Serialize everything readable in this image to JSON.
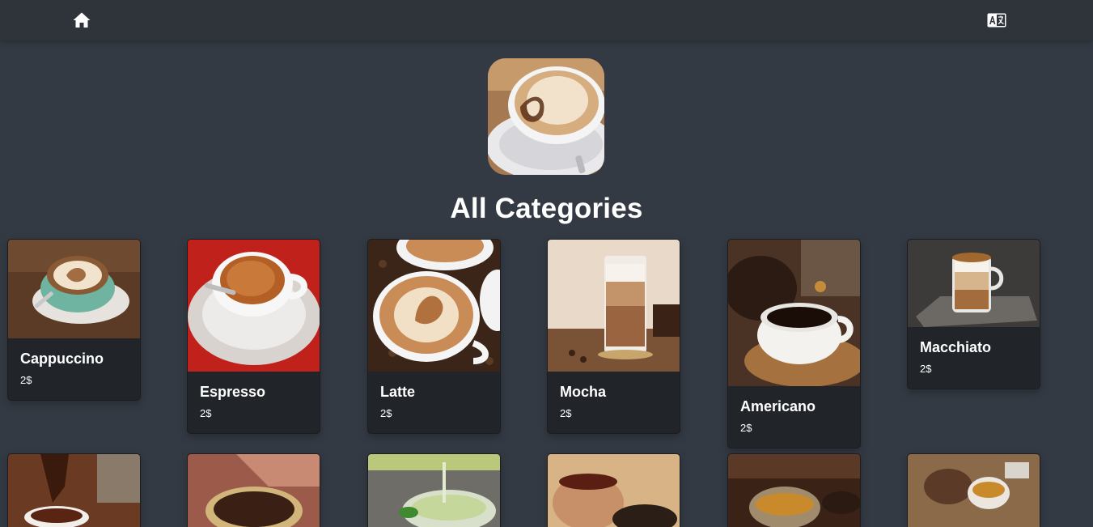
{
  "nav": {
    "home_icon": "home-icon",
    "language_icon": "translate-icon"
  },
  "hero": {
    "logo": "latte-art-cup-image"
  },
  "page": {
    "title": "All Categories"
  },
  "categories": [
    {
      "name": "Cappuccino",
      "price": "2$"
    },
    {
      "name": "Espresso",
      "price": "2$"
    },
    {
      "name": "Latte",
      "price": "2$"
    },
    {
      "name": "Mocha",
      "price": "2$"
    },
    {
      "name": "Americano",
      "price": "2$"
    },
    {
      "name": "Macchiato",
      "price": "2$"
    }
  ],
  "colors": {
    "page_bg": "#343a43",
    "navbar_bg": "#2f343b",
    "card_bg": "#212529",
    "text": "#ffffff"
  }
}
